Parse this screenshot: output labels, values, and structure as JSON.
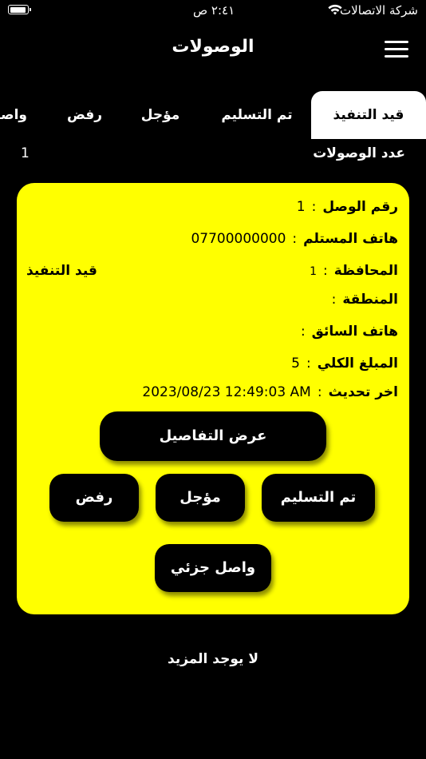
{
  "status_bar": {
    "carrier": "شركة الاتصالات",
    "time": "٢:٤١ ص",
    "battery_level": 0.95,
    "wifi_icon": "wifi-icon"
  },
  "header": {
    "title": "الوصولات",
    "menu_icon": "hamburger-menu-icon"
  },
  "tabs": [
    {
      "label": "قيد التنفيذ",
      "active": true
    },
    {
      "label": "تم التسليم",
      "active": false
    },
    {
      "label": "مؤجل",
      "active": false
    },
    {
      "label": "رفض",
      "active": false
    },
    {
      "label": "واصل جزئي",
      "active": false
    }
  ],
  "count": {
    "label": "عدد الوصولات",
    "value": "1"
  },
  "receipt": {
    "number_label": "رقم الوصل",
    "number_value": "1",
    "recipient_phone_label": "هاتف المستلم",
    "recipient_phone_value": "07700000000",
    "governorate_label": "المحافظة",
    "governorate_value": "1",
    "status": "قيد التنفيذ",
    "area_label": "المنطقة",
    "area_value": "",
    "driver_phone_label": "هاتف السائق",
    "driver_phone_value": "",
    "total_label": "المبلغ الكلي",
    "total_value": "5",
    "updated_label": "اخر تحديث",
    "updated_value": "2023/08/23 12:49:03 AM",
    "separator": ":"
  },
  "actions": {
    "details": "عرض التفاصيل",
    "delivered": "تم التسليم",
    "postponed": "مؤجل",
    "rejected": "رفض",
    "partial": "واصل جزئي"
  },
  "footer": {
    "no_more": "لا يوجد المزيد"
  },
  "colors": {
    "background": "#000000",
    "card": "#ffff00",
    "button": "#000000",
    "active_tab": "#ffffff"
  }
}
